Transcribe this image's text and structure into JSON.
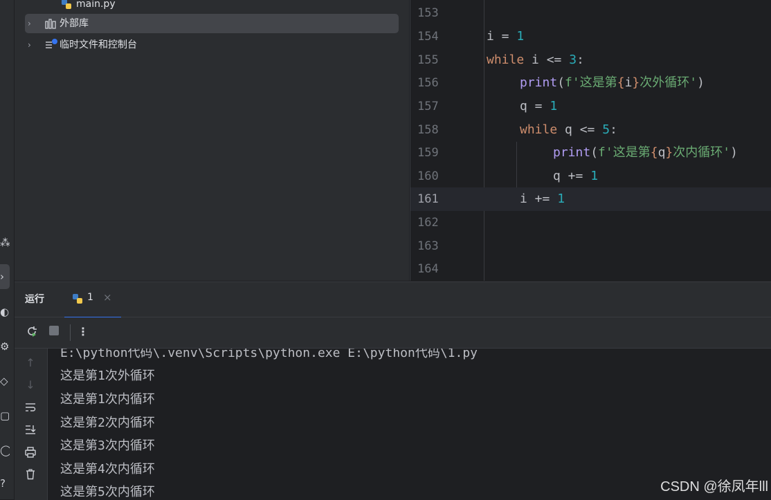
{
  "project_tree": {
    "items": [
      {
        "label": "main.py",
        "icon": "python-file-icon"
      },
      {
        "label": "外部库",
        "icon": "library-icon"
      },
      {
        "label": "临时文件和控制台",
        "icon": "scratches-icon"
      }
    ]
  },
  "editor": {
    "lines": [
      {
        "number": "153"
      },
      {
        "number": "154"
      },
      {
        "number": "155"
      },
      {
        "number": "156"
      },
      {
        "number": "157"
      },
      {
        "number": "158"
      },
      {
        "number": "159"
      },
      {
        "number": "160"
      },
      {
        "number": "161"
      },
      {
        "number": "162"
      },
      {
        "number": "163"
      },
      {
        "number": "164"
      }
    ],
    "code": {
      "l154": {
        "var": "i",
        "op": " = ",
        "num": "1"
      },
      "l155": {
        "kw": "while",
        "rest": " i <= ",
        "num": "3",
        "end": ":"
      },
      "l156": {
        "fn": "print",
        "open": "(",
        "str1": "f'这是第",
        "lb": "{",
        "var": "i",
        "rb": "}",
        "str2": "次外循环'",
        "close": ")"
      },
      "l157": {
        "var": "q",
        "op": " = ",
        "num": "1"
      },
      "l158": {
        "kw": "while",
        "rest": " q <= ",
        "num": "5",
        "end": ":"
      },
      "l159": {
        "fn": "print",
        "open": "(",
        "str1": "f'这是第",
        "lb": "{",
        "var": "q",
        "rb": "}",
        "str2": "次内循环'",
        "close": ")"
      },
      "l160": {
        "var": "q",
        "op": " += ",
        "num": "1"
      },
      "l161": {
        "var": "i",
        "op": " += ",
        "num": "1"
      }
    }
  },
  "run_panel": {
    "title": "运行",
    "tab_label": "1",
    "tab_close": "×",
    "console_lines": [
      "E:\\python代码\\.venv\\Scripts\\python.exe E:\\python代码\\1.py",
      "这是第1次外循环",
      "这是第1次内循环",
      "这是第2次内循环",
      "这是第3次内循环",
      "这是第4次内循环",
      "这是第5次内循环"
    ]
  },
  "watermark": "CSDN @徐凤年lll",
  "colors": {
    "keyword": "#cf8e6d",
    "number": "#2aacb8",
    "function": "#b09cf2",
    "string": "#6aab73",
    "accent": "#3574f0"
  }
}
